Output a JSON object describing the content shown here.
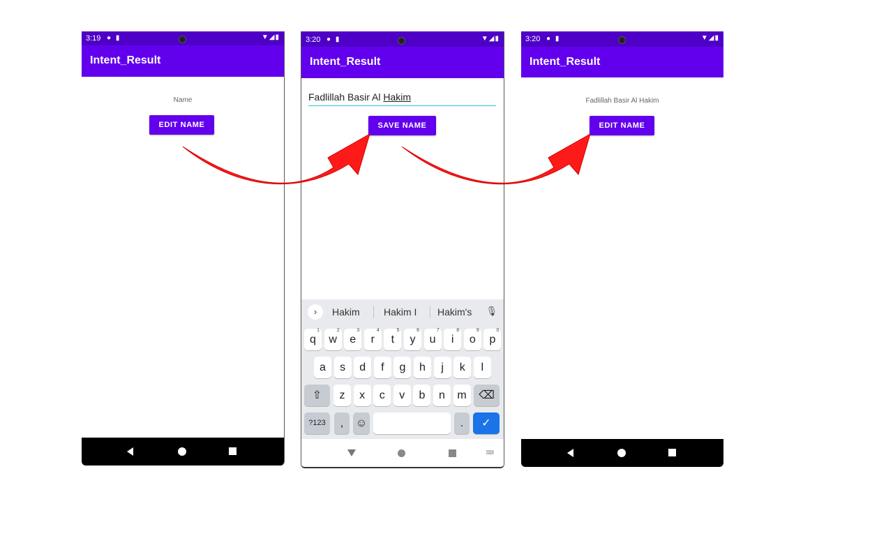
{
  "screens": [
    {
      "status_time": "3:19",
      "app_title": "Intent_Result",
      "label": "Name",
      "button": "EDIT NAME"
    },
    {
      "status_time": "3:20",
      "app_title": "Intent_Result",
      "input_value_prefix": "Fadlillah Basir Al ",
      "input_value_underlined": "Hakim",
      "button": "SAVE NAME",
      "keyboard": {
        "suggestions": [
          "Hakim",
          "Hakim I",
          "Hakim's"
        ],
        "row1": [
          "q",
          "w",
          "e",
          "r",
          "t",
          "y",
          "u",
          "i",
          "o",
          "p"
        ],
        "row1_hints": [
          "1",
          "2",
          "3",
          "4",
          "5",
          "6",
          "7",
          "8",
          "9",
          "0"
        ],
        "row2": [
          "a",
          "s",
          "d",
          "f",
          "g",
          "h",
          "j",
          "k",
          "l"
        ],
        "row3": [
          "z",
          "x",
          "c",
          "v",
          "b",
          "n",
          "m"
        ],
        "symbols_key": "?123",
        "comma_key": ",",
        "period_key": "."
      }
    },
    {
      "status_time": "3:20",
      "app_title": "Intent_Result",
      "label": "Fadlillah Basir Al Hakim",
      "button": "EDIT NAME"
    }
  ],
  "colors": {
    "status_bar": "#4e00c7",
    "app_bar": "#6200ee",
    "button": "#6200ee",
    "arrow": "#ff0000",
    "input_underline": "#26c6da",
    "keyboard_enter": "#1a73e8"
  },
  "icons": [
    "signal-icon",
    "wifi-icon",
    "battery-icon",
    "back-icon",
    "home-icon",
    "recents-icon",
    "mic-icon",
    "shift-icon",
    "backspace-icon",
    "emoji-icon",
    "checkmark-icon",
    "keyboard-icon"
  ]
}
